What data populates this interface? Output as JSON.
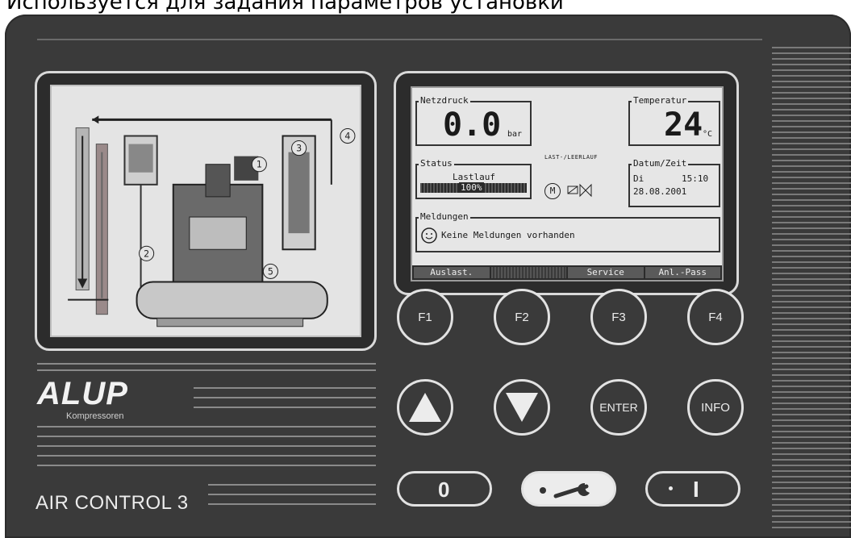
{
  "caption": "Используется для задания параметров установки",
  "diagram": {
    "markers": [
      "1",
      "2",
      "3",
      "4",
      "5"
    ]
  },
  "lcd": {
    "pressure": {
      "title": "Netzdruck",
      "value": "0.0",
      "unit": "bar"
    },
    "temperature": {
      "title": "Temperatur",
      "value": "24",
      "unit": "°C"
    },
    "mode": "LAST-/LEERLAUF",
    "status": {
      "title": "Status",
      "value": "Lastlauf",
      "percent": "100%"
    },
    "datetime": {
      "title": "Datum/Zeit",
      "day": "Di",
      "time": "15:10",
      "date": "28.08.2001"
    },
    "motor_symbol": "M",
    "messages": {
      "title": "Meldungen",
      "text": "Keine Meldungen vorhanden"
    },
    "softkeys": [
      "Auslast.",
      "",
      "Service",
      "Anl.-Pass"
    ]
  },
  "buttons": {
    "f1": "F1",
    "f2": "F2",
    "f3": "F3",
    "f4": "F4",
    "enter": "ENTER",
    "info": "INFO",
    "off": "0",
    "start": "I"
  },
  "brand": {
    "name": "ALUP",
    "sub": "Kompressoren",
    "model": "AIR CONTROL 3"
  },
  "colors": {
    "panel": "#3a3a3a",
    "lcd": "#e6e6e6",
    "button_ring": "#e2e2e2"
  }
}
